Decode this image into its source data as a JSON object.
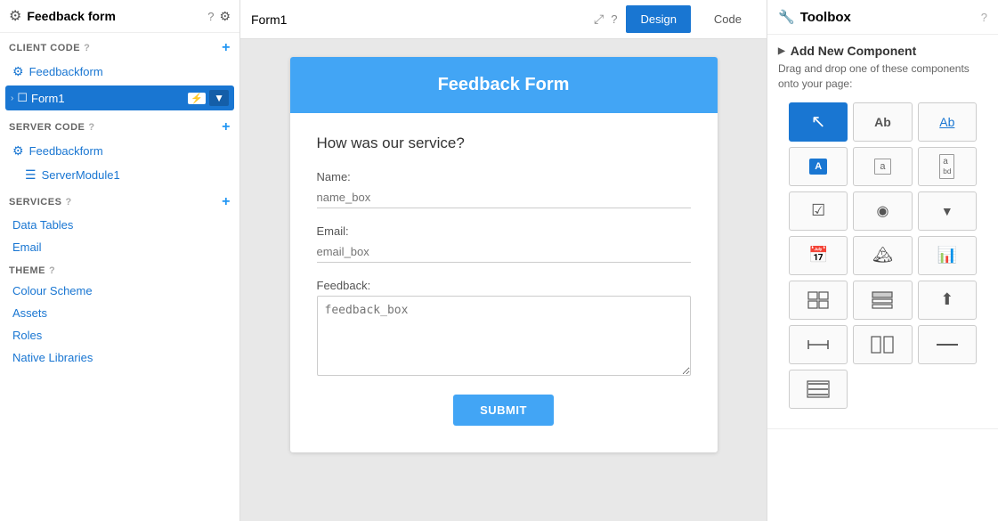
{
  "sidebar": {
    "header": {
      "title": "Feedback form",
      "help_label": "?",
      "gear_label": "⚙"
    },
    "client_code_label": "CLIENT CODE",
    "client_code_help": "?",
    "client_items": [
      {
        "label": "Feedbackform",
        "icon": "⚙"
      },
      {
        "label": "Form1",
        "icon": "☐"
      }
    ],
    "form1": {
      "chevron": "›",
      "icon": "☐",
      "label": "Form1",
      "lightning": "⚡",
      "dropdown": "▼"
    },
    "server_code_label": "SERVER CODE",
    "server_code_help": "?",
    "server_items": [
      {
        "label": "Feedbackform",
        "icon": "⚙"
      },
      {
        "label": "ServerModule1",
        "icon": "☰",
        "indented": true
      }
    ],
    "services_label": "SERVICES",
    "services_help": "?",
    "service_items": [
      {
        "label": "Data Tables"
      },
      {
        "label": "Email"
      }
    ],
    "theme_label": "THEME",
    "theme_help": "?",
    "theme_items": [
      {
        "label": "Colour Scheme"
      },
      {
        "label": "Assets"
      },
      {
        "label": "Roles"
      },
      {
        "label": "Native Libraries"
      }
    ]
  },
  "center": {
    "form_title": "Form1",
    "tab_design": "Design",
    "tab_code": "Code",
    "form_banner": "Feedback Form",
    "form_question": "How was our service?",
    "fields": [
      {
        "label": "Name:",
        "placeholder": "name_box",
        "type": "text"
      },
      {
        "label": "Email:",
        "placeholder": "email_box",
        "type": "text"
      },
      {
        "label": "Feedback:",
        "placeholder": "feedback_box",
        "type": "textarea"
      }
    ],
    "submit_label": "SUBMIT"
  },
  "toolbox": {
    "header_title": "Toolbox",
    "header_help": "?",
    "add_new_title": "Add New Component",
    "add_new_desc": "Drag and drop one of these components onto your page:",
    "components": [
      {
        "name": "pointer",
        "type": "cursor",
        "active": true
      },
      {
        "name": "label",
        "type": "label"
      },
      {
        "name": "label-outline",
        "type": "label-outline"
      },
      {
        "name": "button",
        "type": "button-solid"
      },
      {
        "name": "textbox",
        "type": "textbox-outline"
      },
      {
        "name": "textbox-multiline",
        "type": "textbox-bd"
      },
      {
        "name": "checkbox",
        "type": "check"
      },
      {
        "name": "radio",
        "type": "radio"
      },
      {
        "name": "dropdown",
        "type": "dropdown"
      },
      {
        "name": "date-picker",
        "type": "calendar"
      },
      {
        "name": "image",
        "type": "image"
      },
      {
        "name": "chart",
        "type": "chart"
      },
      {
        "name": "data-grid",
        "type": "datagrid"
      },
      {
        "name": "data-grid-2",
        "type": "datagrid2"
      },
      {
        "name": "file-upload",
        "type": "upload"
      },
      {
        "name": "spacer",
        "type": "spacer"
      },
      {
        "name": "columns",
        "type": "columns"
      },
      {
        "name": "separator",
        "type": "separator"
      },
      {
        "name": "repeating-panel",
        "type": "repeating"
      }
    ]
  }
}
